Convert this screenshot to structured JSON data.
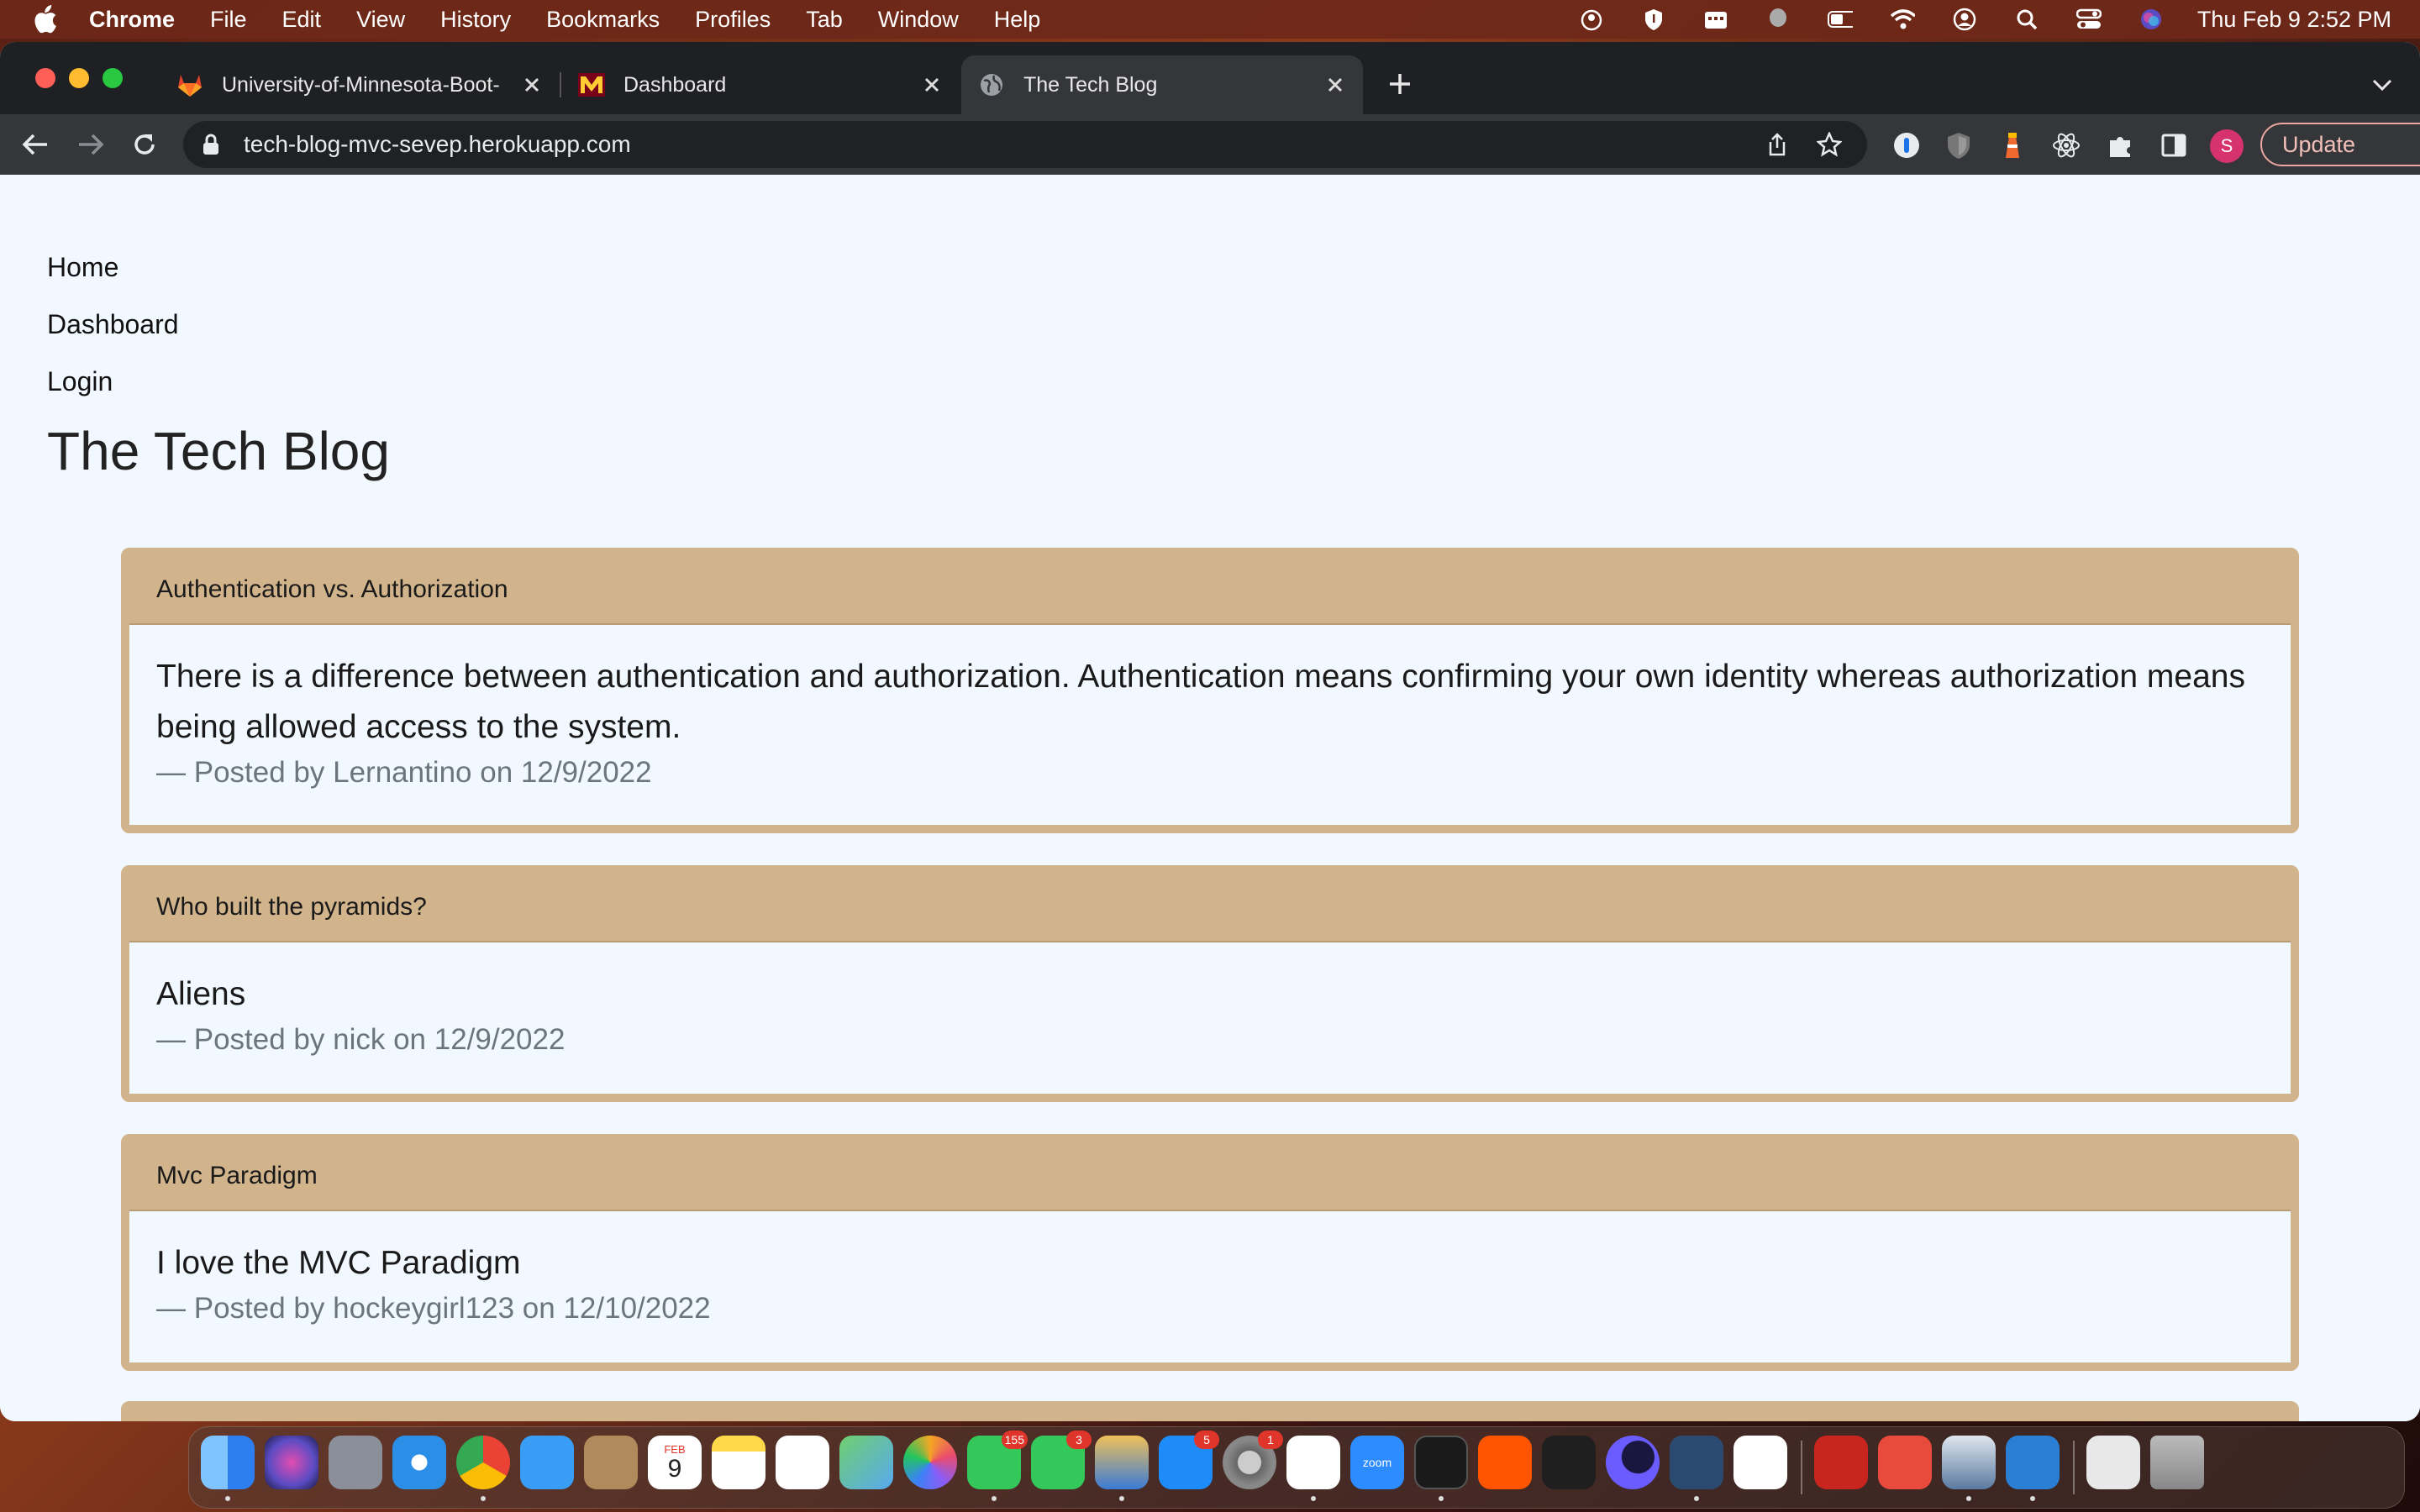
{
  "menubar": {
    "app_name": "Chrome",
    "items": [
      "File",
      "Edit",
      "View",
      "History",
      "Bookmarks",
      "Profiles",
      "Tab",
      "Window",
      "Help"
    ],
    "clock": "Thu Feb 9  2:52 PM"
  },
  "browser": {
    "tabs": [
      {
        "title": "University-of-Minnesota-Boot-",
        "favicon": "gitlab-icon"
      },
      {
        "title": "Dashboard",
        "favicon": "minnesota-m-icon"
      },
      {
        "title": "The Tech Blog",
        "favicon": "globe-icon"
      }
    ],
    "url": "tech-blog-mvc-sevep.herokuapp.com",
    "profile_initial": "S",
    "update_label": "Update"
  },
  "site": {
    "nav": {
      "home": "Home",
      "dashboard": "Dashboard",
      "login": "Login"
    },
    "title": "The Tech Blog",
    "posts": [
      {
        "title": "Authentication vs. Authorization",
        "content": "There is a difference between authentication and authorization. Authentication means confirming your own identity whereas authorization means being allowed access to the system.",
        "meta": "— Posted by Lernantino on 12/9/2022"
      },
      {
        "title": "Who built the pyramids?",
        "content": "Aliens",
        "meta": "— Posted by nick on 12/9/2022"
      },
      {
        "title": "Mvc Paradigm",
        "content": "I love the MVC Paradigm",
        "meta": "— Posted by hockeygirl123 on 12/10/2022"
      }
    ]
  },
  "dock": {
    "badges": {
      "messages": "155",
      "facetime": "3",
      "appstore": "5",
      "settings": "1"
    },
    "calendar": {
      "month": "FEB",
      "day": "9"
    },
    "zoom_label": "zoom"
  },
  "colors": {
    "card_accent": "#d2b48c",
    "page_bg": "#f2f8ff",
    "avatar": "#d6336c"
  }
}
